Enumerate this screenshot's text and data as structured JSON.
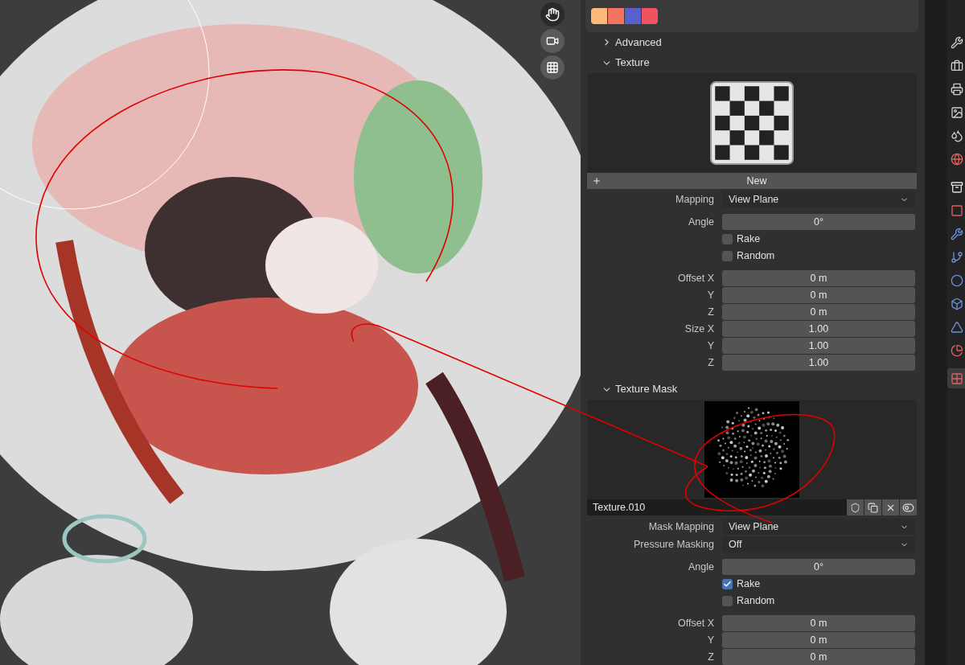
{
  "palette": {
    "colors": [
      {
        "color": "#fdb97a"
      },
      {
        "color": "#f47361"
      },
      {
        "color": "#5860cb"
      },
      {
        "color": "#f0525e"
      }
    ]
  },
  "advanced": {
    "title": "Advanced",
    "expanded": false
  },
  "texture": {
    "title": "Texture",
    "expanded": true,
    "new_button": "New",
    "fields": [
      {
        "kind": "dropdown",
        "label": "Mapping",
        "value": "View Plane"
      },
      {
        "kind": "number",
        "label": "Angle",
        "value": "0°"
      },
      {
        "kind": "checkbox",
        "text": "Rake",
        "checked": false
      },
      {
        "kind": "checkbox",
        "text": "Random",
        "checked": false
      },
      {
        "kind": "number",
        "label": "Offset X",
        "value": "0 m"
      },
      {
        "kind": "number",
        "label": "Y",
        "value": "0 m"
      },
      {
        "kind": "number",
        "label": "Z",
        "value": "0 m"
      },
      {
        "kind": "number",
        "label": "Size X",
        "value": "1.00"
      },
      {
        "kind": "number",
        "label": "Y",
        "value": "1.00"
      },
      {
        "kind": "number",
        "label": "Z",
        "value": "1.00"
      }
    ]
  },
  "texture_mask": {
    "title": "Texture Mask",
    "expanded": true,
    "texture_name": "Texture.010",
    "fields": [
      {
        "kind": "dropdown",
        "label": "Mask Mapping",
        "value": "View Plane"
      },
      {
        "kind": "dropdown",
        "label": "Pressure Masking",
        "value": "Off"
      },
      {
        "kind": "number",
        "label": "Angle",
        "value": "0°"
      },
      {
        "kind": "checkbox",
        "text": "Rake",
        "checked": true
      },
      {
        "kind": "checkbox",
        "text": "Random",
        "checked": false
      },
      {
        "kind": "number",
        "label": "Offset X",
        "value": "0 m"
      },
      {
        "kind": "number",
        "label": "Y",
        "value": "0 m"
      },
      {
        "kind": "number",
        "label": "Z",
        "value": "0 m"
      }
    ]
  },
  "property_tabs": [
    {
      "selected": false
    },
    {
      "selected": false
    },
    {
      "selected": false
    },
    {
      "selected": false
    },
    {
      "selected": false
    },
    {
      "selected": false
    },
    {
      "selected": false
    },
    {
      "selected": false
    },
    {
      "selected": false
    },
    {
      "selected": false
    },
    {
      "selected": false
    },
    {
      "selected": false
    },
    {
      "selected": false
    },
    {
      "selected": false
    },
    {
      "selected": true
    }
  ]
}
